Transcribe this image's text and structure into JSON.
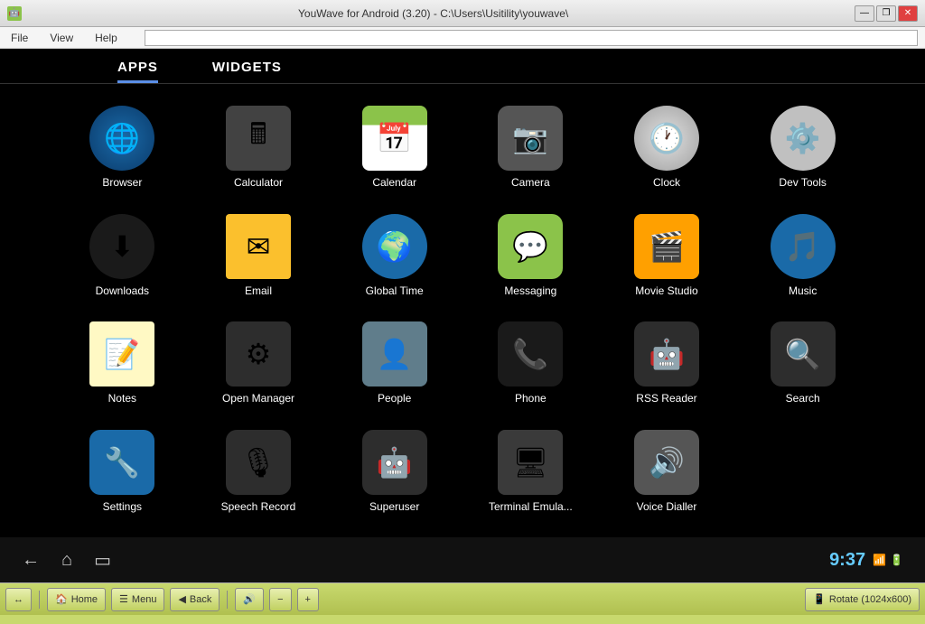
{
  "window": {
    "title": "YouWave for Android (3.20) - C:\\Users\\Usitility\\youwave\\",
    "icon": "🤖"
  },
  "menu": {
    "items": [
      "File",
      "View",
      "Help"
    ]
  },
  "tabs": [
    {
      "id": "apps",
      "label": "APPS",
      "active": true
    },
    {
      "id": "widgets",
      "label": "WIDGETS",
      "active": false
    }
  ],
  "apps": [
    {
      "id": "browser",
      "label": "Browser",
      "icon": "🌐",
      "class": "icon-browser"
    },
    {
      "id": "calculator",
      "label": "Calculator",
      "icon": "🖩",
      "class": "icon-calculator"
    },
    {
      "id": "calendar",
      "label": "Calendar",
      "icon": "📅",
      "class": "icon-calendar"
    },
    {
      "id": "camera",
      "label": "Camera",
      "icon": "📷",
      "class": "icon-camera"
    },
    {
      "id": "clock",
      "label": "Clock",
      "icon": "🕐",
      "class": "icon-clock"
    },
    {
      "id": "devtools",
      "label": "Dev Tools",
      "icon": "⚙️",
      "class": "icon-devtools"
    },
    {
      "id": "downloads",
      "label": "Downloads",
      "icon": "⬇",
      "class": "icon-downloads"
    },
    {
      "id": "email",
      "label": "Email",
      "icon": "✉",
      "class": "icon-email"
    },
    {
      "id": "globaltime",
      "label": "Global Time",
      "icon": "🌍",
      "class": "icon-globaltime"
    },
    {
      "id": "messaging",
      "label": "Messaging",
      "icon": "💬",
      "class": "icon-messaging"
    },
    {
      "id": "moviestudio",
      "label": "Movie Studio",
      "icon": "🎬",
      "class": "icon-movie"
    },
    {
      "id": "music",
      "label": "Music",
      "icon": "🎵",
      "class": "icon-music"
    },
    {
      "id": "notes",
      "label": "Notes",
      "icon": "📝",
      "class": "icon-notes"
    },
    {
      "id": "openmanager",
      "label": "Open Manager",
      "icon": "⚙",
      "class": "icon-openmanager"
    },
    {
      "id": "people",
      "label": "People",
      "icon": "👤",
      "class": "icon-people"
    },
    {
      "id": "phone",
      "label": "Phone",
      "icon": "📞",
      "class": "icon-phone"
    },
    {
      "id": "rssreader",
      "label": "RSS Reader",
      "icon": "🤖",
      "class": "icon-rssreader"
    },
    {
      "id": "search",
      "label": "Search",
      "icon": "🔍",
      "class": "icon-search"
    },
    {
      "id": "settings",
      "label": "Settings",
      "icon": "🔧",
      "class": "icon-settings"
    },
    {
      "id": "speechrecord",
      "label": "Speech Record",
      "icon": "🎙",
      "class": "icon-speechrecord"
    },
    {
      "id": "superuser",
      "label": "Superuser",
      "icon": "🤖",
      "class": "icon-superuser"
    },
    {
      "id": "terminal",
      "label": "Terminal Emula...",
      "icon": "🖥",
      "class": "icon-terminal"
    },
    {
      "id": "voicedialler",
      "label": "Voice Dialler",
      "icon": "🔊",
      "class": "icon-voicedialler"
    }
  ],
  "navbar": {
    "back_icon": "←",
    "home_icon": "⌂",
    "recent_icon": "▭",
    "clock": "9:37",
    "status": "📶🔋"
  },
  "taskbar": {
    "arrows_icon": "↔",
    "home_btn": "Home",
    "menu_btn": "Menu",
    "back_btn": "Back",
    "volume_icon": "🔊",
    "volume_minus": "-",
    "volume_plus": "+",
    "rotate_btn": "Rotate (1024x600)",
    "device_icon": "📱"
  }
}
